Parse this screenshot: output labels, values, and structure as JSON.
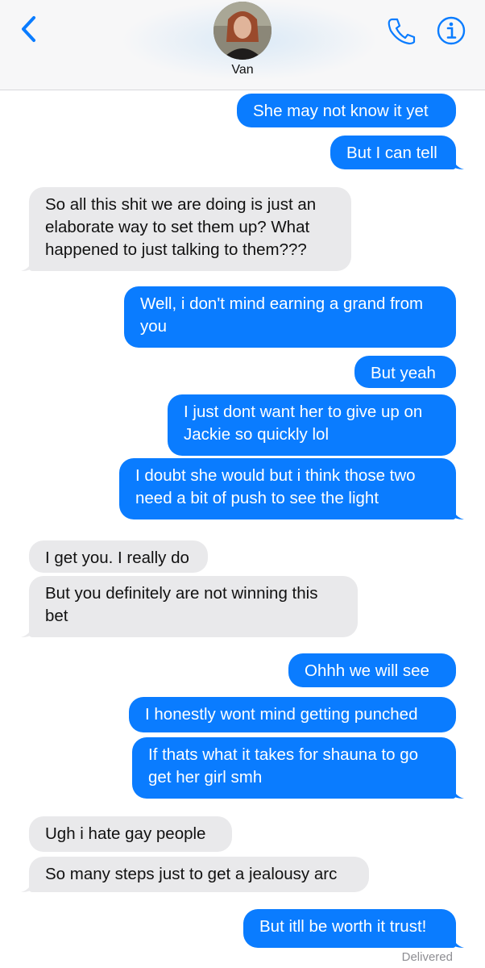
{
  "header": {
    "contact_name": "Van"
  },
  "messages": [
    {
      "side": "out",
      "lines": [
        "She may not know it yet"
      ]
    },
    {
      "side": "out",
      "lines": [
        "But I can tell"
      ]
    },
    {
      "side": "in",
      "lines": [
        "So all this shit we are doing is just an",
        "elaborate way to set them up? What",
        "happened to just talking to them???"
      ]
    },
    {
      "side": "out",
      "lines": [
        "Well, i don't mind earning a grand from",
        "you"
      ]
    },
    {
      "side": "out",
      "lines": [
        "But yeah"
      ]
    },
    {
      "side": "out",
      "lines": [
        "I just dont want her to give up on",
        "Jackie so quickly lol"
      ]
    },
    {
      "side": "out",
      "lines": [
        "I doubt she would but i think those two",
        "need a bit of push to see the light"
      ]
    },
    {
      "side": "in",
      "lines": [
        "I get you. I really do"
      ]
    },
    {
      "side": "in",
      "lines": [
        "But you definitely are not winning this",
        "bet"
      ]
    },
    {
      "side": "out",
      "lines": [
        "Ohhh we will see"
      ]
    },
    {
      "side": "out",
      "lines": [
        "I honestly wont mind getting punched"
      ]
    },
    {
      "side": "out",
      "lines": [
        "If thats what it takes for shauna to go",
        "get her girl smh"
      ]
    },
    {
      "side": "in",
      "lines": [
        "Ugh i hate gay people"
      ]
    },
    {
      "side": "in",
      "lines": [
        "So many steps just to get a jealousy arc"
      ]
    },
    {
      "side": "out",
      "lines": [
        "But itll be worth it trust!"
      ]
    }
  ],
  "status": {
    "delivered": "Delivered"
  },
  "colors": {
    "outgoing": "#0a7cff",
    "incoming": "#e9e9eb",
    "accent": "#0a7cff"
  },
  "icons": {
    "back": "chevron-left-icon",
    "call": "phone-icon",
    "info": "info-icon"
  }
}
